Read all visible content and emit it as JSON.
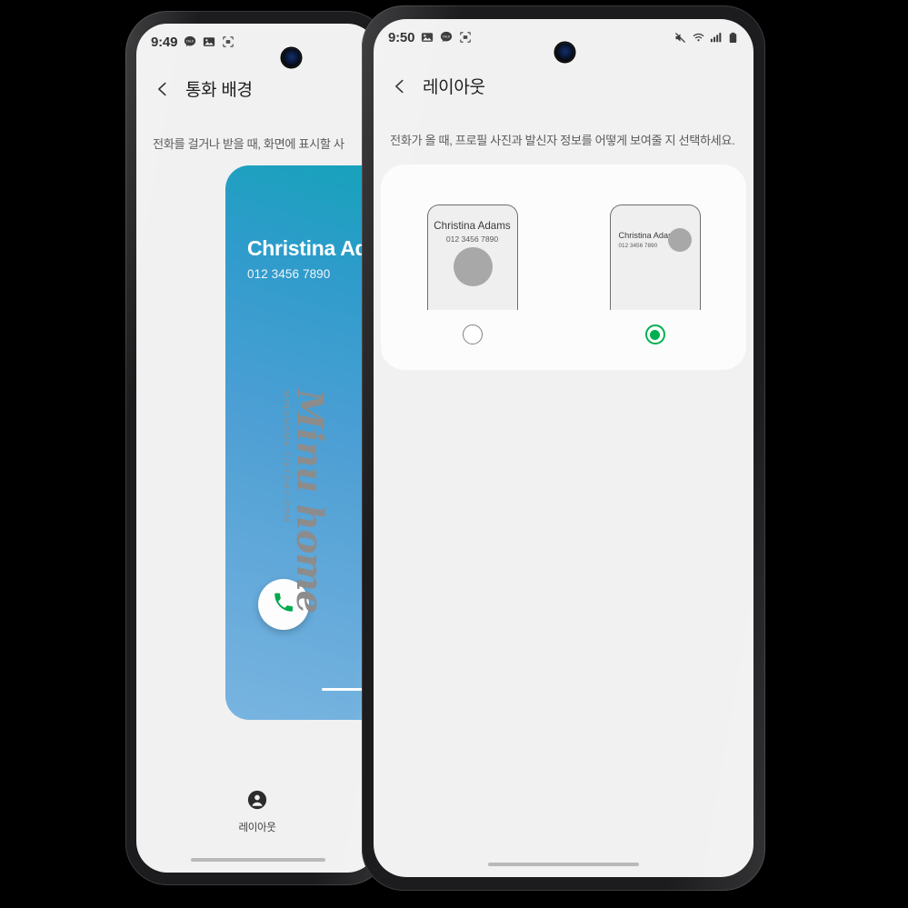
{
  "colors": {
    "accent_green": "#00b050",
    "call_green": "#00a94f",
    "card_gradient_top": "#13a3b8",
    "card_gradient_bottom": "#79b4e0",
    "screen_bg": "#f1f1f1",
    "panel_bg": "#fcfcfc"
  },
  "left_phone": {
    "status": {
      "time": "9:49",
      "icons": [
        "kakaotalk-icon",
        "gallery-icon",
        "screen-capture-icon"
      ]
    },
    "appbar": {
      "back_icon": "back-chevron-icon",
      "title": "통화 배경"
    },
    "description": "전화를 걸거나 받을 때, 화면에 표시할 사",
    "call_preview": {
      "caller_name": "Christina Ada",
      "caller_number": "012 3456 7890",
      "answer_icon": "phone-handset-icon"
    },
    "bottom_nav": {
      "icon": "person-circle-icon",
      "label": "레이아웃"
    }
  },
  "right_phone": {
    "status": {
      "time": "9:50",
      "left_icons": [
        "gallery-icon",
        "kakaotalk-icon",
        "screen-capture-icon"
      ],
      "right_icons": [
        "mute-icon",
        "wifi-icon",
        "signal-icon",
        "battery-icon"
      ]
    },
    "appbar": {
      "back_icon": "back-chevron-icon",
      "title": "레이아웃"
    },
    "description": "전화가 올 때, 프로필 사진과 발신자 정보를 어떻게 보여줄 지 선택하세요.",
    "options": [
      {
        "id": "full-screen-layout",
        "caller_name": "Christina Adams",
        "caller_number": "012 3456 7890",
        "selected": false
      },
      {
        "id": "compact-layout",
        "caller_name": "Christina Adams",
        "caller_number": "012 3456 7890",
        "selected": true
      }
    ]
  },
  "watermark": {
    "script": "Minu home",
    "url": "MINUHOME.TISTORY.COM"
  }
}
